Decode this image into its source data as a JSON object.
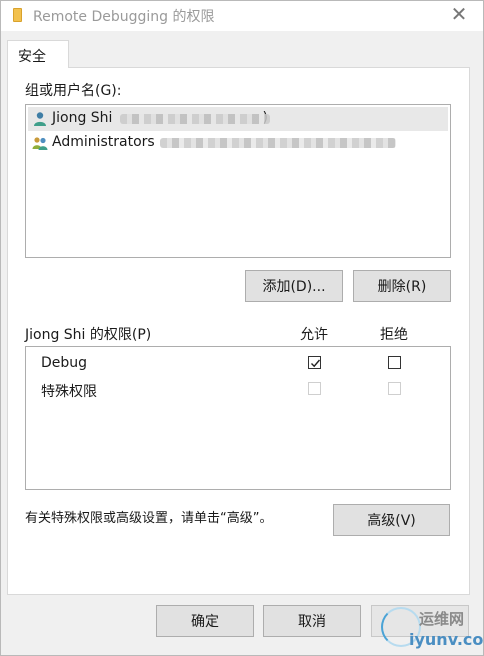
{
  "window": {
    "title": "Remote Debugging 的权限",
    "close_glyph": "✕"
  },
  "tabs": [
    {
      "label": "安全"
    }
  ],
  "users_section": {
    "label": "组或用户名(G):",
    "users": [
      {
        "name": "Jiong Shi",
        "suffix": ")",
        "icon": "user-icon"
      },
      {
        "name": "Administrators",
        "icon": "group-icon"
      }
    ]
  },
  "buttons": {
    "add": "添加(D)...",
    "remove": "删除(R)",
    "advanced": "高级(V)",
    "ok": "确定",
    "cancel": "取消"
  },
  "permissions_section": {
    "label": "Jiong Shi 的权限(P)",
    "allow_header": "允许",
    "deny_header": "拒绝",
    "rows": [
      {
        "name": "Debug",
        "allow": true,
        "deny": false,
        "enabled": true
      },
      {
        "name": "特殊权限",
        "allow": false,
        "deny": false,
        "enabled": false
      }
    ]
  },
  "advanced_hint": "有关特殊权限或高级设置，请单击“高级”。",
  "watermark": {
    "line1": "运维网",
    "line2": "iyunv.com"
  },
  "colors": {
    "accent": "#4aa3d6",
    "button_bg": "#e1e1e1",
    "dialog_bg": "#f0f0f0"
  }
}
